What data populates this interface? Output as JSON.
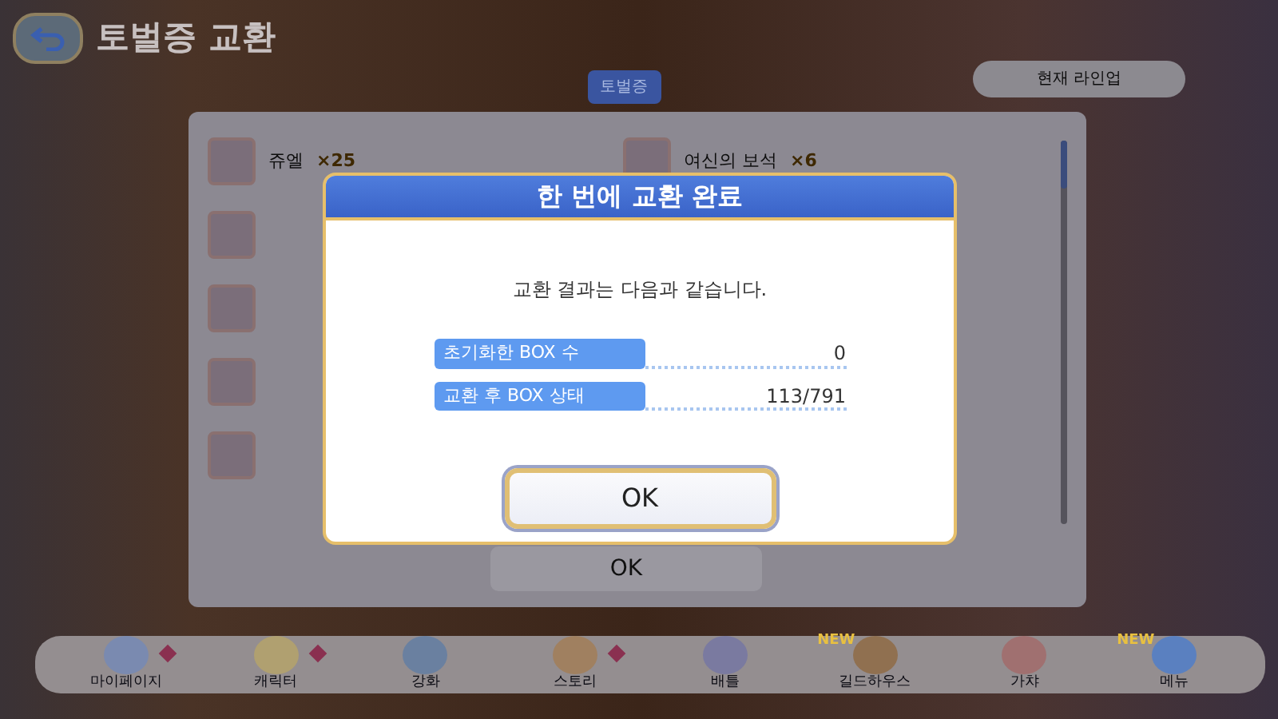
{
  "screen": {
    "title": "토벌증 교환",
    "currency_badge": "토벌증",
    "lineup_button": "현재 라인업"
  },
  "rewards_left": [
    {
      "kind": "labelled",
      "name": "쥬엘",
      "count": "×25"
    },
    {
      "kind": "icon_only"
    },
    {
      "kind": "icon_only"
    },
    {
      "kind": "icon_only"
    },
    {
      "kind": "icon_only"
    }
  ],
  "rewards_right": [
    {
      "kind": "labelled",
      "name": "여신의 보석",
      "count": "×6"
    }
  ],
  "panel_button": "OK",
  "nav": [
    {
      "label": "마이페이지",
      "notice": true
    },
    {
      "label": "캐릭터",
      "notice": true
    },
    {
      "label": "강화",
      "notice": false
    },
    {
      "label": "스토리",
      "notice": true
    },
    {
      "label": "배틀",
      "notice": false
    },
    {
      "label": "길드하우스",
      "notice": false,
      "badge": "NEW"
    },
    {
      "label": "가챠",
      "notice": false
    },
    {
      "label": "메뉴",
      "notice": false,
      "badge": "NEW"
    }
  ],
  "dialog": {
    "title": "한 번에 교환 완료",
    "message": "교환 결과는 다음과 같습니다.",
    "rows": [
      {
        "label": "초기화한 BOX 수",
        "value": "0"
      },
      {
        "label": "교환 후 BOX 상태",
        "value": "113/791"
      }
    ],
    "button": "OK"
  }
}
